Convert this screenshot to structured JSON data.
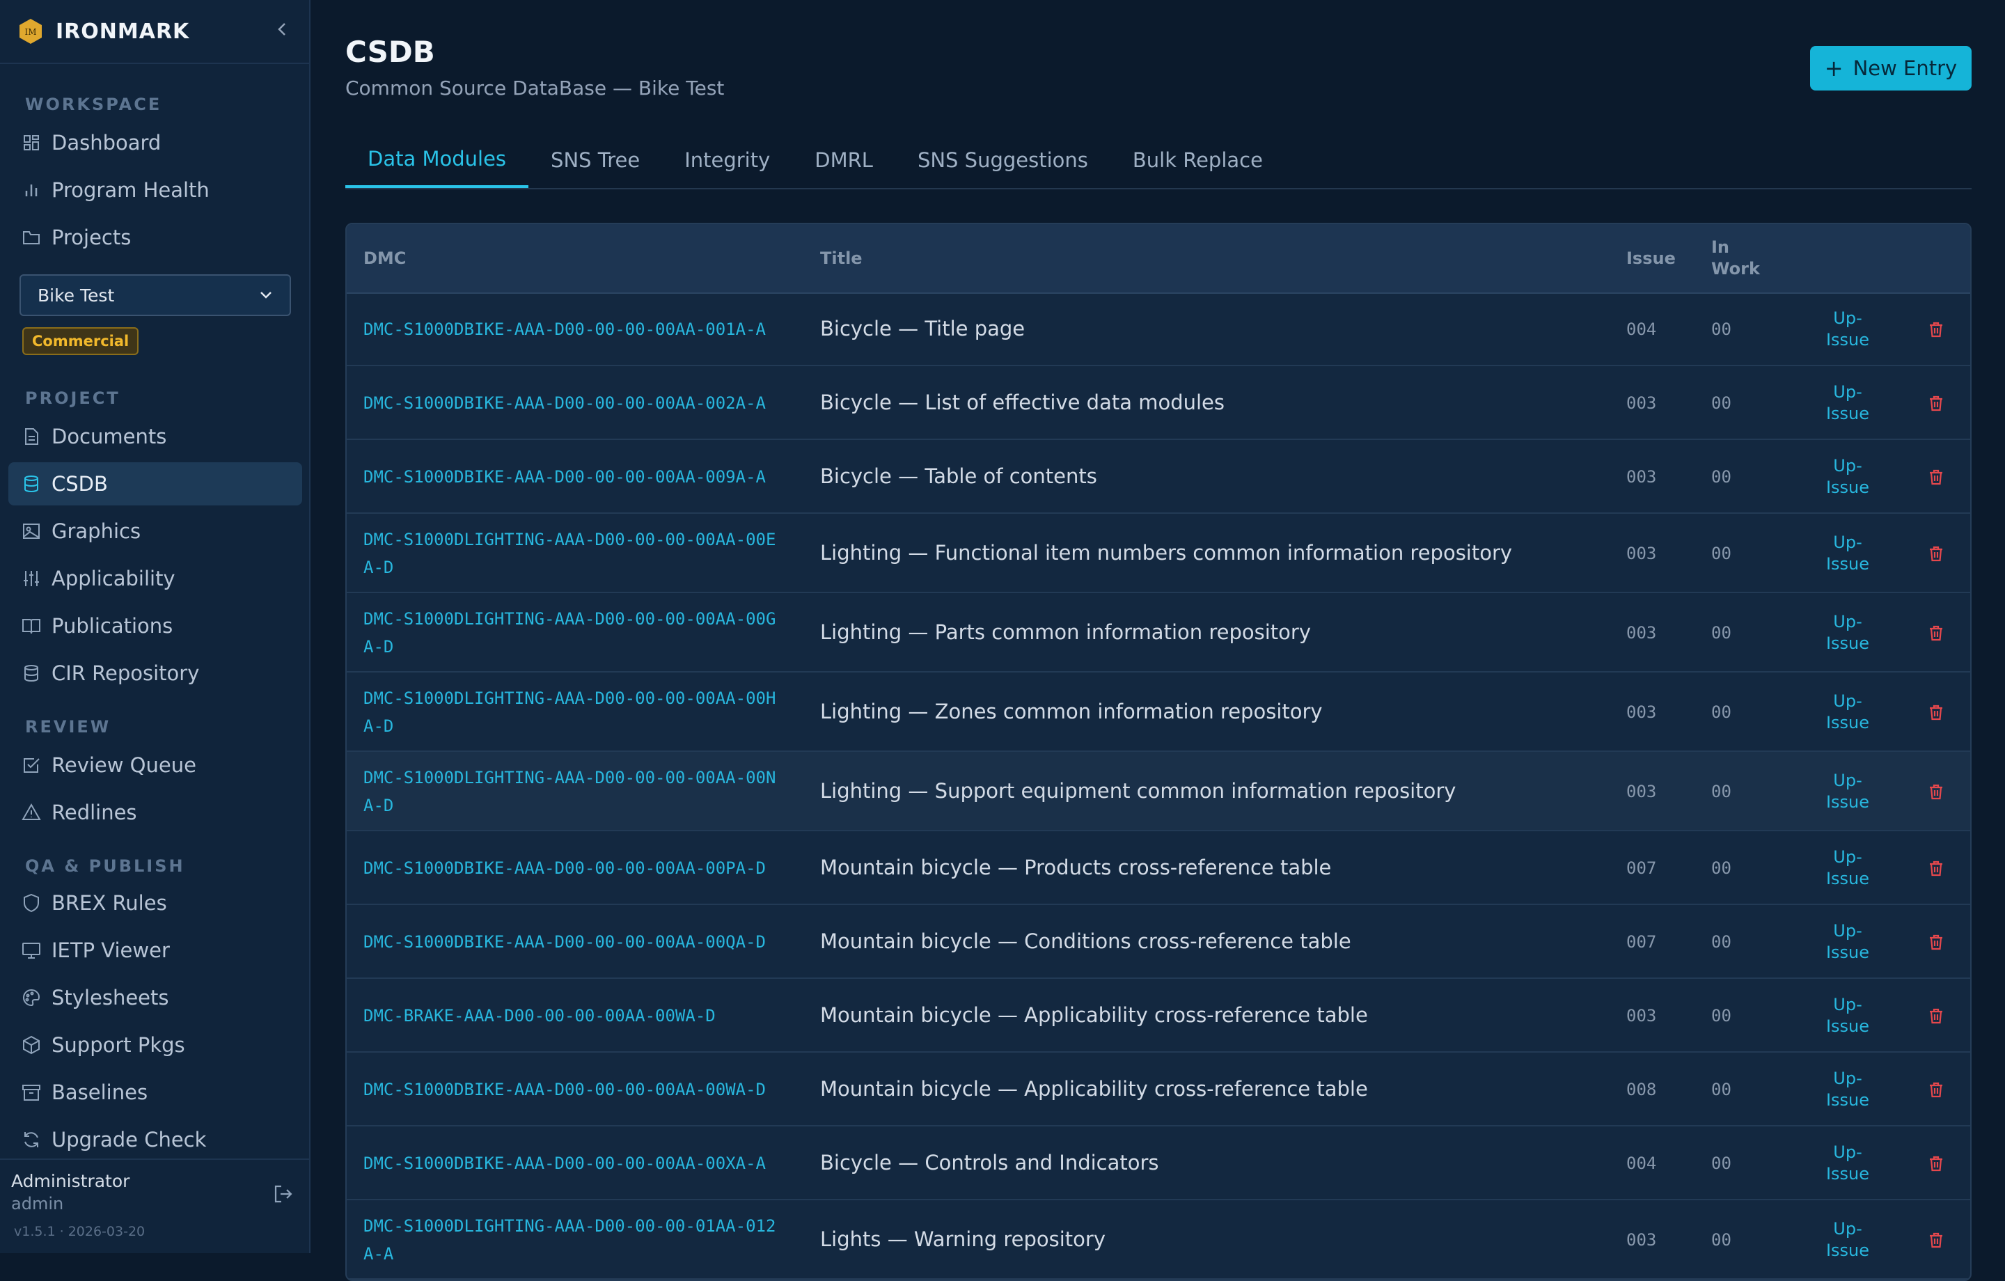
{
  "brand": {
    "name": "IRONMARK",
    "logo_text": "IM"
  },
  "sidebar": {
    "sections": {
      "workspace": "WORKSPACE",
      "project": "PROJECT",
      "review": "REVIEW",
      "qa_publish": "QA & PUBLISH"
    },
    "items": [
      {
        "label": "Dashboard",
        "icon": "dashboard-icon"
      },
      {
        "label": "Program Health",
        "icon": "bar-chart-icon"
      },
      {
        "label": "Projects",
        "icon": "folder-icon"
      },
      {
        "label": "Documents",
        "icon": "document-icon"
      },
      {
        "label": "CSDB",
        "icon": "database-icon",
        "active": true
      },
      {
        "label": "Graphics",
        "icon": "image-icon"
      },
      {
        "label": "Applicability",
        "icon": "sliders-icon"
      },
      {
        "label": "Publications",
        "icon": "book-icon"
      },
      {
        "label": "CIR Repository",
        "icon": "database-icon"
      },
      {
        "label": "Review Queue",
        "icon": "checkbox-icon"
      },
      {
        "label": "Redlines",
        "icon": "warning-icon"
      },
      {
        "label": "BREX Rules",
        "icon": "shield-icon"
      },
      {
        "label": "IETP Viewer",
        "icon": "monitor-icon"
      },
      {
        "label": "Stylesheets",
        "icon": "palette-icon"
      },
      {
        "label": "Support Pkgs",
        "icon": "package-icon"
      },
      {
        "label": "Baselines",
        "icon": "archive-icon"
      },
      {
        "label": "Upgrade Check",
        "icon": "refresh-icon"
      }
    ],
    "project_select": {
      "value": "Bike Test"
    },
    "license_badge": "Commercial",
    "footer": {
      "user_name": "Administrator",
      "user_role": "admin",
      "version": "v1.5.1 · 2026-03-20"
    }
  },
  "header": {
    "title": "CSDB",
    "subtitle": "Common Source DataBase — Bike Test",
    "new_entry_label": "New Entry"
  },
  "tabs": [
    "Data Modules",
    "SNS Tree",
    "Integrity",
    "DMRL",
    "SNS Suggestions",
    "Bulk Replace"
  ],
  "table": {
    "columns": {
      "dmc": "DMC",
      "title": "Title",
      "issue": "Issue",
      "in_work": "In Work"
    },
    "action_label": "Up-Issue",
    "rows": [
      {
        "dmc": "DMC-S1000DBIKE-AAA-D00-00-00-00AA-001A-A",
        "title": "Bicycle — Title page",
        "issue": "004",
        "in_work": "00"
      },
      {
        "dmc": "DMC-S1000DBIKE-AAA-D00-00-00-00AA-002A-A",
        "title": "Bicycle — List of effective data modules",
        "issue": "003",
        "in_work": "00"
      },
      {
        "dmc": "DMC-S1000DBIKE-AAA-D00-00-00-00AA-009A-A",
        "title": "Bicycle — Table of contents",
        "issue": "003",
        "in_work": "00"
      },
      {
        "dmc": "DMC-S1000DLIGHTING-AAA-D00-00-00-00AA-00EA-D",
        "title": "Lighting — Functional item numbers common information repository",
        "issue": "003",
        "in_work": "00"
      },
      {
        "dmc": "DMC-S1000DLIGHTING-AAA-D00-00-00-00AA-00GA-D",
        "title": "Lighting — Parts common information repository",
        "issue": "003",
        "in_work": "00"
      },
      {
        "dmc": "DMC-S1000DLIGHTING-AAA-D00-00-00-00AA-00HA-D",
        "title": "Lighting — Zones common information repository",
        "issue": "003",
        "in_work": "00"
      },
      {
        "dmc": "DMC-S1000DLIGHTING-AAA-D00-00-00-00AA-00NA-D",
        "title": "Lighting — Support equipment common information repository",
        "issue": "003",
        "in_work": "00"
      },
      {
        "dmc": "DMC-S1000DBIKE-AAA-D00-00-00-00AA-00PA-D",
        "title": "Mountain bicycle — Products cross-reference table",
        "issue": "007",
        "in_work": "00"
      },
      {
        "dmc": "DMC-S1000DBIKE-AAA-D00-00-00-00AA-00QA-D",
        "title": "Mountain bicycle — Conditions cross-reference table",
        "issue": "007",
        "in_work": "00"
      },
      {
        "dmc": "DMC-BRAKE-AAA-D00-00-00-00AA-00WA-D",
        "title": "Mountain bicycle — Applicability cross-reference table",
        "issue": "003",
        "in_work": "00"
      },
      {
        "dmc": "DMC-S1000DBIKE-AAA-D00-00-00-00AA-00WA-D",
        "title": "Mountain bicycle — Applicability cross-reference table",
        "issue": "008",
        "in_work": "00"
      },
      {
        "dmc": "DMC-S1000DBIKE-AAA-D00-00-00-00AA-00XA-A",
        "title": "Bicycle — Controls and Indicators",
        "issue": "004",
        "in_work": "00"
      },
      {
        "dmc": "DMC-S1000DLIGHTING-AAA-D00-00-00-01AA-012A-A",
        "title": "Lights — Warning repository",
        "issue": "003",
        "in_work": "00"
      }
    ]
  },
  "colors": {
    "accent": "#2ac3e8",
    "danger": "#e5484d",
    "badge": "#f2b92c"
  }
}
